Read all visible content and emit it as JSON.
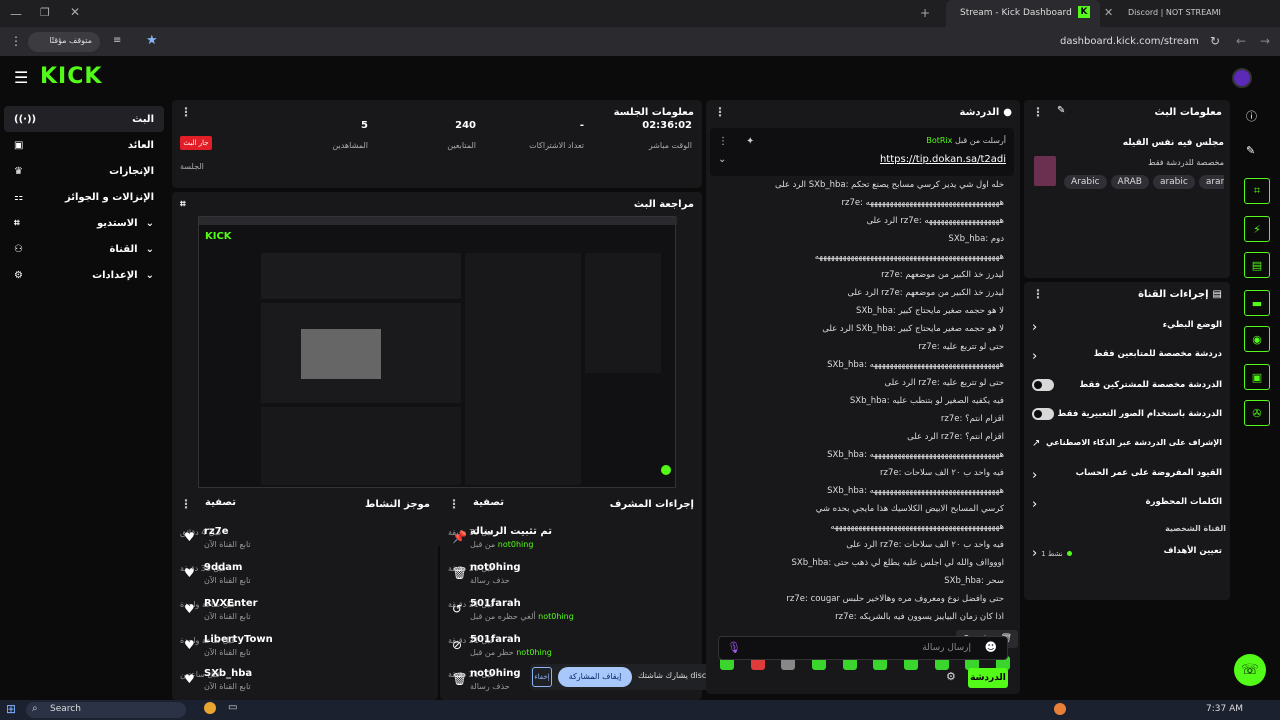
{
  "browser": {
    "tabs": [
      {
        "label": "Stream - Kick Dashboard",
        "active": true
      },
      {
        "label": "Discord | NOT STREAMI",
        "active": false
      }
    ],
    "url": "dashboard.kick.com/stream",
    "paused_label": "متوقف مؤقتًا"
  },
  "brand": {
    "logo": "KICK",
    "accent": "#53fc18"
  },
  "nav": {
    "items": [
      {
        "label": "البث",
        "icon": "broadcast-icon"
      },
      {
        "label": "العائد",
        "icon": "money-icon"
      },
      {
        "label": "الإنجازات",
        "icon": "trophy-icon"
      },
      {
        "label": "الإنزالات و الجوائز",
        "icon": "gift-icon"
      },
      {
        "label": "الاستديو",
        "icon": "studio-icon"
      },
      {
        "label": "القناة",
        "icon": "channel-icon"
      },
      {
        "label": "الإعدادات",
        "icon": "gear-icon"
      }
    ]
  },
  "session": {
    "title": "معلومات الجلسة",
    "live_badge": "جار البث",
    "live_label": "الجلسة",
    "viewers_value": "5",
    "viewers_label": "المشاهدين",
    "followers_value": "240",
    "followers_label": "المتابعين",
    "subs_value": "-",
    "subs_label": "تعداد الاشتراكات",
    "time_value": "02:36:02",
    "time_label": "الوقت مباشر"
  },
  "preview": {
    "title": "مراجعة البث"
  },
  "activity": {
    "title": "موجز النشاط",
    "filter": "تصفية",
    "rows": [
      {
        "name": "rz7e",
        "sub": "تابع القناة الآن",
        "time": "قبل 4 دقائق"
      },
      {
        "name": "9ddam",
        "sub": "تابع القناة الآن",
        "time": "قبل 33 دقيقة"
      },
      {
        "name": "RVXEnter",
        "sub": "تابع القناة الآن",
        "time": "قبل ساعة واحدة"
      },
      {
        "name": "LibertyTown",
        "sub": "تابع القناة الآن",
        "time": "قبل ساعة واحدة"
      },
      {
        "name": "SXb_hba",
        "sub": "تابع القناة الآن",
        "time": "قبل ساعتين"
      }
    ]
  },
  "modactions": {
    "title": "إجراءات المشرف",
    "filter": "تصفية",
    "rows": [
      {
        "name": "تم تثبيت الرسالة",
        "sub": "من قبل",
        "by": "not0hing",
        "time": "قبل 19 دقيقة",
        "icon": "pin-icon"
      },
      {
        "name": "not0hing",
        "sub": "حذف رسالة",
        "by": "",
        "time": "قبل 20 دقيقة",
        "icon": "trash-icon"
      },
      {
        "name": "501farah",
        "sub": "ألغي حظره من قبل",
        "by": "not0hing",
        "time": "قبل 21 دقيقة",
        "icon": "undo-icon"
      },
      {
        "name": "501farah",
        "sub": "حظر من قبل",
        "by": "not0hing",
        "time": "قبل 21 دقيقة",
        "icon": "ban-icon"
      },
      {
        "name": "not0hing",
        "sub": "حذف رسالة",
        "by": "",
        "time": "قبل 21 دقيقة",
        "icon": "trash-icon"
      }
    ]
  },
  "chat": {
    "title": "الدردشة",
    "pinned": {
      "label": "أرسلت من قبل",
      "user": "BotRix",
      "link": "https://tip.dokan.sa/t2adi"
    },
    "lines": [
      {
        "text": "الرد على SXb_hba: ‪خله اول شي يدير كرسي مسابح يصنع تحكم"
      },
      {
        "text": "rz7e: ههههههههههههههههههههههههههههههههههه"
      },
      {
        "text": "الرد على rz7e: هههههههههههههههههههه"
      },
      {
        "text": "SXb_hba: دوم"
      },
      {
        "text": "هههههههههههههههههههههههههههههههههههههههههههههههه"
      },
      {
        "text": "rz7e: ليدرز خذ الكبير من موضعهم"
      },
      {
        "text": "الرد على rz7e: ليدرز خذ الكبير من موضعهم"
      },
      {
        "text": "SXb_hba: لا هو حجمه صغير مايحتاج كبير"
      },
      {
        "text": "الرد على SXb_hba: لا هو حجمه صغير مايحتاج كبير"
      },
      {
        "text": "rz7e: حتى لو تتربع عليه"
      },
      {
        "text": "SXb_hba: هههههههههههههههههههههههههههههههههه"
      },
      {
        "text": "الرد على rz7e: حتى لو تتربع عليه"
      },
      {
        "text": "SXb_hba: فيه يكفيه الصغير لو بتنطب عليه"
      },
      {
        "text": "rz7e: اقزام انتم؟"
      },
      {
        "text": "الرد على rz7e: اقزام انتم؟"
      },
      {
        "text": "SXb_hba: هههههههههههههههههههههههههههههههههه"
      },
      {
        "text": "rz7e: فيه واحد ب ٢٠ الف سلاحات"
      },
      {
        "text": "SXb_hba: هههههههههههههههههههههههههههههههههه"
      },
      {
        "text": "كرسي المسابح الابيض الكلاسيك هذا مايجي بحده شي"
      },
      {
        "text": "هههههههههههههههههههههههههههههههههههههههههههه"
      },
      {
        "text": "الرد على rz7e: فيه واحد ب ٢٠ الف سلاحات"
      },
      {
        "text": "SXb_hba: اوووااف والله لي اجلس عليه يطلع لي ذهب حتى"
      },
      {
        "text": "SXb_hba: سحر"
      },
      {
        "text": "rz7e: cougar حتى وافضل نوع ومعروف مره وهالاخير حلبس"
      },
      {
        "text": "rz7e: اذا كان زمان البيايبز يسوون فيه بالشريكه"
      }
    ],
    "input_placeholder": "إرسال رسالة",
    "send_label": "الدردشة"
  },
  "stream_info": {
    "title": "معلومات البث",
    "stream_title": "مجلس فيه نفس القيله",
    "category": "مخصصة للدردشة فقط",
    "tags": [
      "Arabic",
      "ARAB",
      "arabic",
      "arar",
      "fu"
    ]
  },
  "channel_actions": {
    "title": "إجراءات القناة",
    "items": [
      {
        "label": "الوضع البطيء",
        "control": "chevron"
      },
      {
        "label": "دردشة مخصصة للمتابعين فقط",
        "control": "chevron"
      },
      {
        "label": "الدردشة مخصصة للمشتركين فقط",
        "control": "toggle"
      },
      {
        "label": "الدردشة باستخدام الصور التعبيرية فقط",
        "control": "toggle"
      },
      {
        "label": "الإشراف على الدردشة عبر الذكاء الاصطناعي",
        "control": "external"
      },
      {
        "label": "القيود المفروضة على عمر الحساب",
        "control": "chevron"
      },
      {
        "label": "الكلمات المحظورة",
        "control": "chevron"
      }
    ],
    "personal_title": "القناة الشخصية",
    "goals_label": "تعيين الأهداف",
    "goals_count": "نشط 1"
  },
  "share_bar": {
    "text": "يشارك شاشتك discord.com",
    "stop": "إيقاف المشاركة",
    "hide": "إخفاء"
  },
  "taskbar": {
    "search": "Search",
    "time": "7:37 AM"
  }
}
